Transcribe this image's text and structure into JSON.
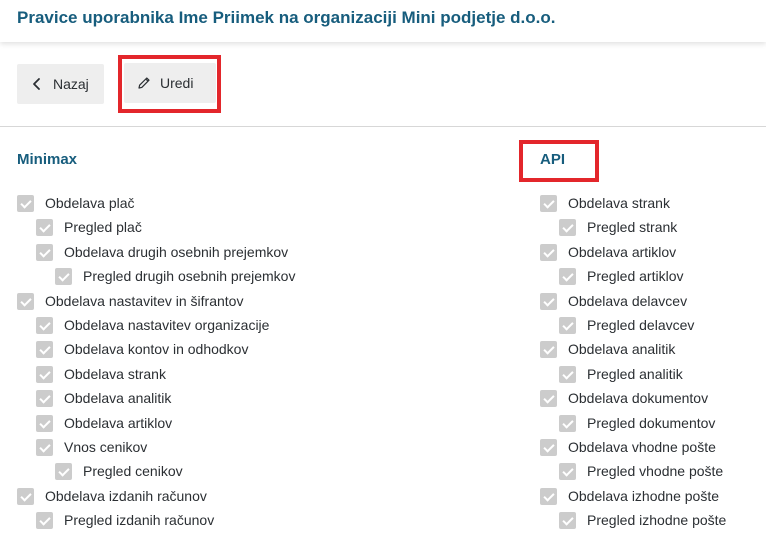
{
  "header": {
    "title": "Pravice uporabnika Ime Priimek na organizaciji Mini podjetje d.o.o."
  },
  "toolbar": {
    "back_label": "Nazaj",
    "edit_label": "Uredi"
  },
  "colors": {
    "title": "#175d7d",
    "highlight": "#e3262b",
    "checkbox": "#cccccc",
    "button_bg": "#eeeeee"
  },
  "sections": [
    {
      "title": "Minimax",
      "items": [
        {
          "label": "Obdelava plač",
          "level": 0,
          "checked": true
        },
        {
          "label": "Pregled plač",
          "level": 1,
          "checked": true
        },
        {
          "label": "Obdelava drugih osebnih prejemkov",
          "level": 1,
          "checked": true
        },
        {
          "label": "Pregled drugih osebnih prejemkov",
          "level": 2,
          "checked": true
        },
        {
          "label": "Obdelava nastavitev in šifrantov",
          "level": 0,
          "checked": true
        },
        {
          "label": "Obdelava nastavitev organizacije",
          "level": 1,
          "checked": true
        },
        {
          "label": "Obdelava kontov in odhodkov",
          "level": 1,
          "checked": true
        },
        {
          "label": "Obdelava strank",
          "level": 1,
          "checked": true
        },
        {
          "label": "Obdelava analitik",
          "level": 1,
          "checked": true
        },
        {
          "label": "Obdelava artiklov",
          "level": 1,
          "checked": true
        },
        {
          "label": "Vnos cenikov",
          "level": 1,
          "checked": true
        },
        {
          "label": "Pregled cenikov",
          "level": 2,
          "checked": true
        },
        {
          "label": "Obdelava izdanih računov",
          "level": 0,
          "checked": true
        },
        {
          "label": "Pregled izdanih računov",
          "level": 1,
          "checked": true
        }
      ]
    },
    {
      "title": "API",
      "items": [
        {
          "label": "Obdelava strank",
          "level": 0,
          "checked": true
        },
        {
          "label": "Pregled strank",
          "level": 1,
          "checked": true
        },
        {
          "label": "Obdelava artiklov",
          "level": 0,
          "checked": true
        },
        {
          "label": "Pregled artiklov",
          "level": 1,
          "checked": true
        },
        {
          "label": "Obdelava delavcev",
          "level": 0,
          "checked": true
        },
        {
          "label": "Pregled delavcev",
          "level": 1,
          "checked": true
        },
        {
          "label": "Obdelava analitik",
          "level": 0,
          "checked": true
        },
        {
          "label": "Pregled analitik",
          "level": 1,
          "checked": true
        },
        {
          "label": "Obdelava dokumentov",
          "level": 0,
          "checked": true
        },
        {
          "label": "Pregled dokumentov",
          "level": 1,
          "checked": true
        },
        {
          "label": "Obdelava vhodne pošte",
          "level": 0,
          "checked": true
        },
        {
          "label": "Pregled vhodne pošte",
          "level": 1,
          "checked": true
        },
        {
          "label": "Obdelava izhodne pošte",
          "level": 0,
          "checked": true
        },
        {
          "label": "Pregled izhodne pošte",
          "level": 1,
          "checked": true
        }
      ]
    }
  ]
}
